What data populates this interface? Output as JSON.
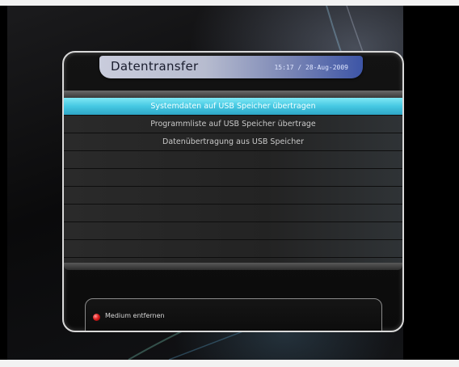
{
  "dialog": {
    "title": "Datentransfer",
    "datetime": "15:17 / 28-Aug-2009"
  },
  "menu": {
    "items": [
      {
        "label": "Systemdaten auf USB Speicher übertragen",
        "selected": true
      },
      {
        "label": "Programmliste auf USB Speicher übertrage",
        "selected": false
      },
      {
        "label": "Datenübertragung aus USB Speicher",
        "selected": false
      },
      {
        "label": "",
        "selected": false
      },
      {
        "label": "",
        "selected": false
      },
      {
        "label": "",
        "selected": false
      },
      {
        "label": "",
        "selected": false
      },
      {
        "label": "",
        "selected": false
      },
      {
        "label": "",
        "selected": false
      }
    ]
  },
  "footer": {
    "red_button_label": "Medium entfernen",
    "red_button_icon": "red-circle-icon"
  },
  "colors": {
    "selection": "#45c8e2",
    "header_accent": "#3d55a6",
    "red_key": "#e02020"
  }
}
